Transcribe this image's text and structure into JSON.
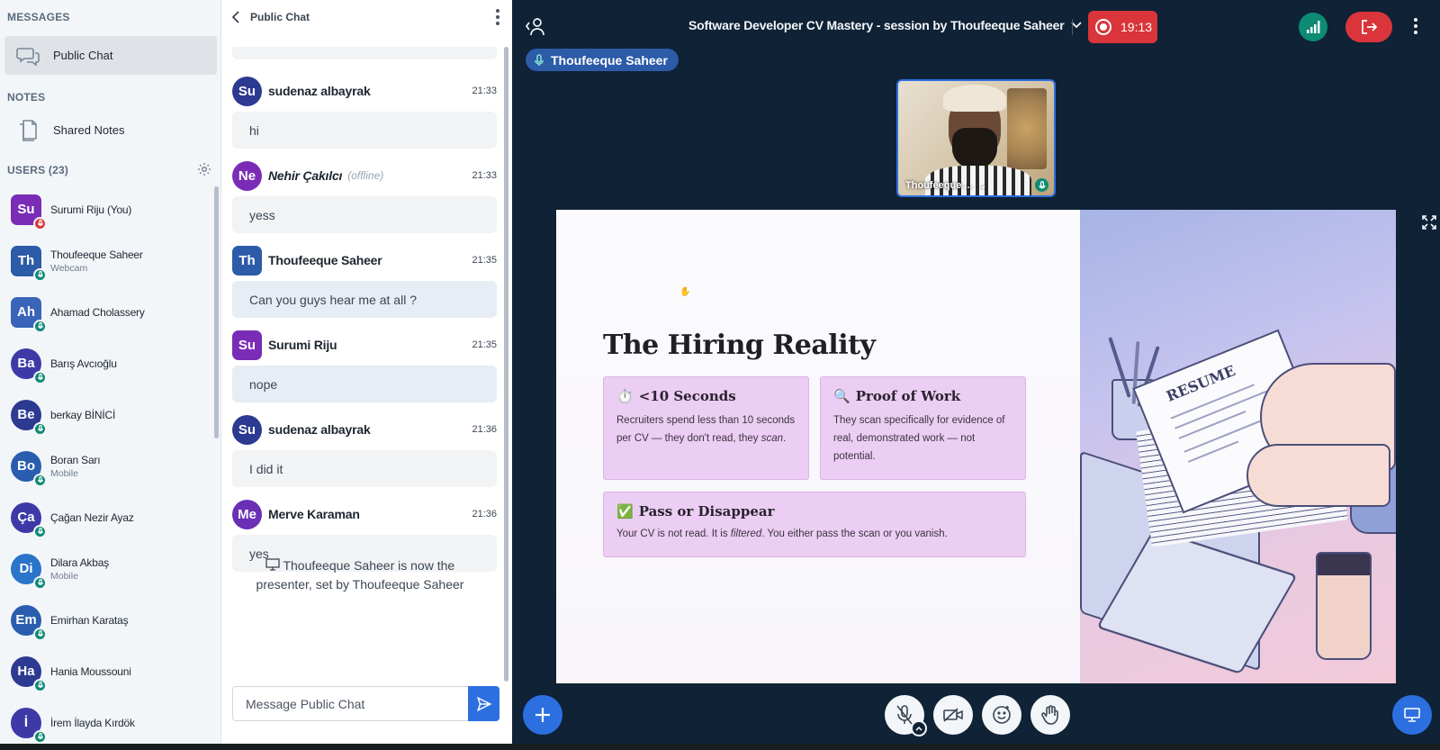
{
  "sidebar": {
    "messages_title": "MESSAGES",
    "public_chat_label": "Public Chat",
    "notes_title": "NOTES",
    "shared_notes_label": "Shared Notes",
    "users_title": "USERS (23)",
    "users": [
      {
        "initials": "Su",
        "name": "Surumi Riju (You)",
        "sub": "",
        "color": "#7a2cb7",
        "badge": "red",
        "shape": "square"
      },
      {
        "initials": "Th",
        "name": "Thoufeeque Saheer",
        "sub": "Webcam",
        "color": "#2c5ba8",
        "badge": "green",
        "shape": "square"
      },
      {
        "initials": "Ah",
        "name": "Ahamad Cholassery",
        "sub": "",
        "color": "#3a64b8",
        "badge": "green",
        "shape": "square"
      },
      {
        "initials": "Ba",
        "name": "Barış Avcıoğlu",
        "sub": "",
        "color": "#3d3aa8",
        "badge": "green",
        "shape": "round"
      },
      {
        "initials": "Be",
        "name": "berkay BİNİCİ",
        "sub": "",
        "color": "#2d3a91",
        "badge": "green",
        "shape": "round"
      },
      {
        "initials": "Bo",
        "name": "Boran Sarı",
        "sub": "Mobile",
        "color": "#2a5dae",
        "badge": "green",
        "shape": "round"
      },
      {
        "initials": "Ça",
        "name": "Çağan Nezir Ayaz",
        "sub": "",
        "color": "#3d3aa8",
        "badge": "green",
        "shape": "round"
      },
      {
        "initials": "Di",
        "name": "Dilara Akbaş",
        "sub": "Mobile",
        "color": "#2a74c9",
        "badge": "green",
        "shape": "round"
      },
      {
        "initials": "Em",
        "name": "Emirhan Karataş",
        "sub": "",
        "color": "#2a5dae",
        "badge": "green",
        "shape": "round"
      },
      {
        "initials": "Ha",
        "name": "Hania Moussouni",
        "sub": "",
        "color": "#2d3a91",
        "badge": "green",
        "shape": "round"
      },
      {
        "initials": "İ",
        "name": "İrem İlayda Kırdök",
        "sub": "",
        "color": "#3d3aa8",
        "badge": "green",
        "shape": "round"
      }
    ]
  },
  "chat": {
    "header_title": "Public Chat",
    "messages": [
      {
        "initials": "Su",
        "name": "sudenaz albayrak",
        "time": "21:33",
        "text": "hi",
        "color": "#2d3a91",
        "shape": "round",
        "offline": "",
        "blue": false
      },
      {
        "initials": "Ne",
        "name": "Nehir Çakılcı",
        "time": "21:33",
        "text": "yess",
        "color": "#7a2cb7",
        "shape": "round",
        "offline": "(offline)",
        "blue": false
      },
      {
        "initials": "Th",
        "name": "Thoufeeque Saheer",
        "time": "21:35",
        "text": "Can you guys hear me at all ?",
        "color": "#2c5ba8",
        "shape": "square",
        "offline": "",
        "blue": true
      },
      {
        "initials": "Su",
        "name": "Surumi Riju",
        "time": "21:35",
        "text": "nope",
        "color": "#7a2cb7",
        "shape": "square",
        "offline": "",
        "blue": true
      },
      {
        "initials": "Su",
        "name": "sudenaz albayrak",
        "time": "21:36",
        "text": "I did it",
        "color": "#2d3a91",
        "shape": "round",
        "offline": "",
        "blue": false
      },
      {
        "initials": "Me",
        "name": "Merve Karaman",
        "time": "21:36",
        "text": "yes",
        "color": "#6a2fb5",
        "shape": "round",
        "offline": "",
        "blue": false
      }
    ],
    "system_message": "Thoufeeque Saheer is now the presenter, set by Thoufeeque Saheer",
    "input_placeholder": "Message Public Chat"
  },
  "stage": {
    "meeting_title": "Software Developer CV Mastery - session by Thoufeeque Saheer",
    "recording_time": "19:13",
    "talking_user": "Thoufeeque Saheer",
    "webcam_name": "Thoufeeque ...",
    "colors": {
      "record": "#d9353a",
      "connection": "#0d8b74",
      "accent": "#2c6fe0"
    }
  },
  "slide": {
    "title": "The Hiring Reality",
    "cards": [
      {
        "emoji": "⏱️",
        "title": "<10 Seconds",
        "body_before": "Recruiters spend less than 10 seconds per CV — they don't read, they ",
        "body_em": "scan",
        "body_after": "."
      },
      {
        "emoji": "🔍",
        "title": "Proof of Work",
        "body_before": "They scan specifically for evidence of real, demonstrated work — not potential.",
        "body_em": "",
        "body_after": ""
      },
      {
        "emoji": "✅",
        "title": "Pass or Disappear",
        "body_before": "Your CV is not read. It is ",
        "body_em": "filtered",
        "body_after": ". You either pass the scan or you vanish."
      }
    ],
    "art_text": "RESUME"
  }
}
